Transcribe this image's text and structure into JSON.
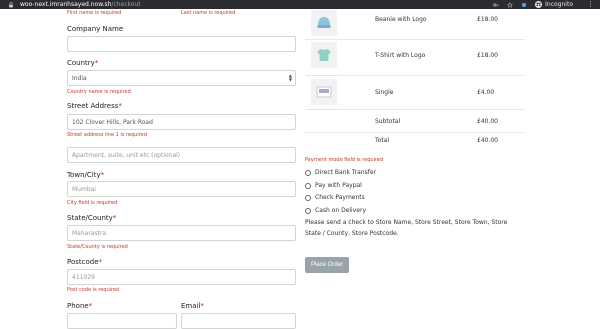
{
  "browser": {
    "url_host": "woo-next.imranhsayed.now.sh",
    "url_path": "/checkout",
    "incognito_label": "Incognito",
    "kebab": "⋮"
  },
  "form": {
    "first_name_error": "First name is required",
    "last_name_error": "Last name is required",
    "company_label": "Company Name",
    "company_value": "",
    "country_label": "Country",
    "country_value": "India",
    "country_error": "Country name is required",
    "street_label": "Street Address",
    "street_value": "102 Clover Hills, Park Road",
    "street_error": "Street address line 1 is required",
    "street2_placeholder": "Apartment, suite, unit etc.(optional)",
    "city_label": "Town/City",
    "city_value": "Mumbai",
    "city_error": "City field is required",
    "state_label": "State/County",
    "state_value": "Maharastra",
    "state_error": "State/County is required",
    "postcode_label": "Postcode",
    "postcode_value": "411029",
    "postcode_error": "Post code is required",
    "phone_label": "Phone",
    "email_label": "Email",
    "required_mark": "*"
  },
  "order": {
    "items": [
      {
        "name": "Beanie with Logo",
        "price": "£18.00",
        "icon": "beanie-thumbnail"
      },
      {
        "name": "T-Shirt with Logo",
        "price": "£18.00",
        "icon": "tshirt-thumbnail"
      },
      {
        "name": "Single",
        "price": "£4.00",
        "icon": "album-thumbnail"
      }
    ],
    "subtotal_label": "Subtotal",
    "subtotal_value": "£40.00",
    "total_label": "Total",
    "total_value": "£40.00"
  },
  "payment": {
    "error": "Payment mode field is required",
    "options": [
      "Direct Bank Transfer",
      "Pay with Paypal",
      "Check Payments",
      "Cash on Delivery"
    ],
    "note": "Please send a check to Store Name, Store Street, Store Town, Store State / County, Store Postcode.",
    "place_order_label": "Place Order"
  },
  "colors": {
    "error": "#c0392b",
    "button": "#98a4ab",
    "chrome": "#2b2c2f"
  }
}
